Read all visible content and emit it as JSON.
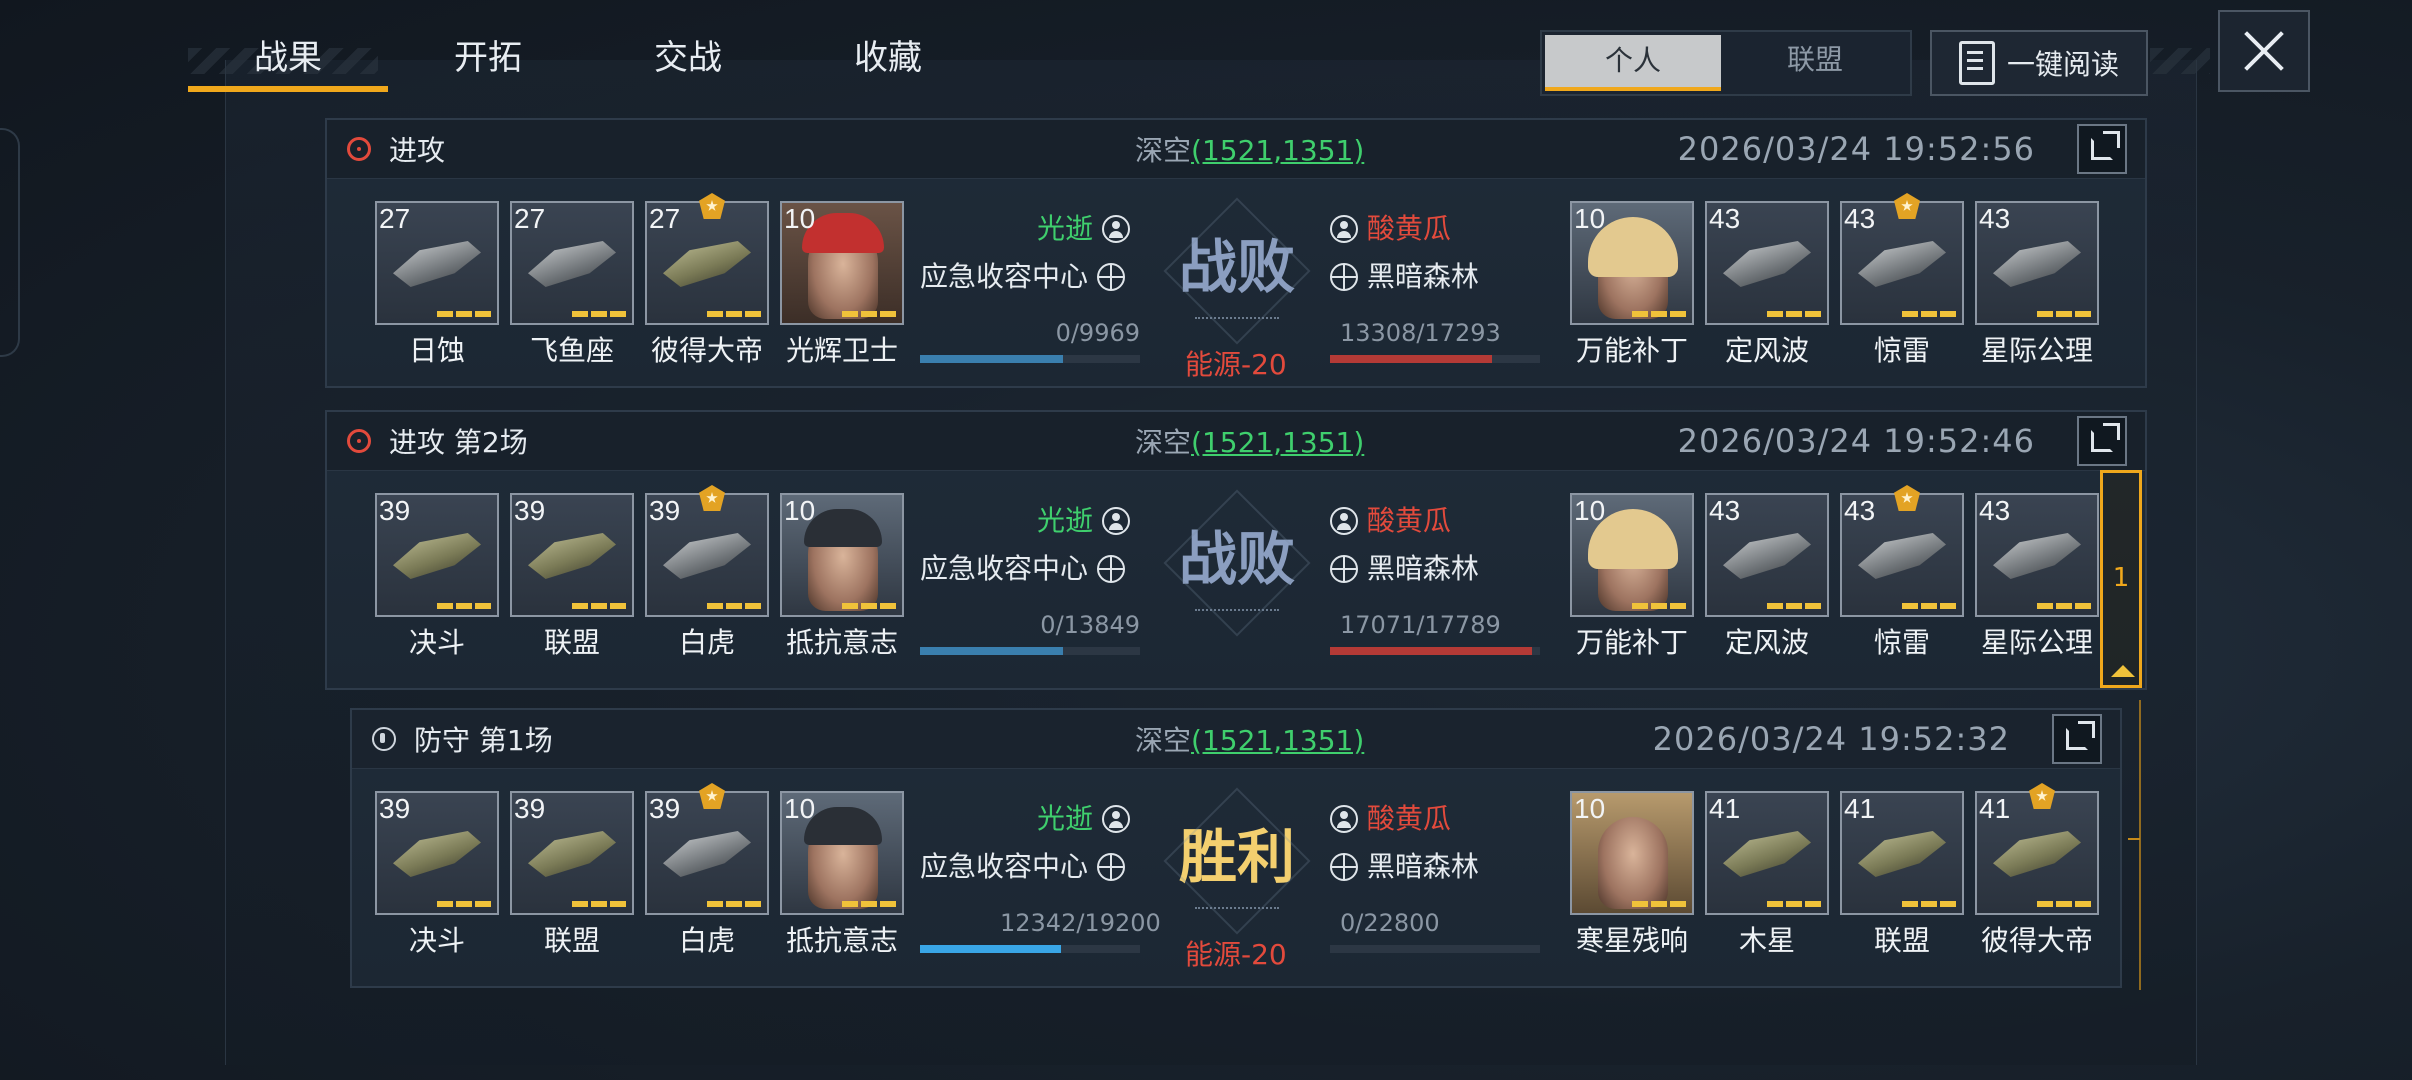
{
  "top_tabs": [
    {
      "label": "战果",
      "active": true
    },
    {
      "label": "开拓",
      "active": false
    },
    {
      "label": "交战",
      "active": false
    },
    {
      "label": "收藏",
      "active": false
    }
  ],
  "segment": {
    "personal": "个人",
    "alliance": "联盟"
  },
  "read_all_label": "一键阅读",
  "colors": {
    "accent": "#f0a81c",
    "ally": "#3fcf6d",
    "enemy": "#e24a3c",
    "lose": "#8b9ec0",
    "win": "#f3cf6f"
  },
  "battles": [
    {
      "title": "进攻",
      "type": "attack",
      "location": "深空",
      "coord": "(1521,1351)",
      "time": "2026/03/24 19:52:56",
      "left": {
        "player": "光逝",
        "guild": "应急收容中心",
        "hp": "0/9969",
        "hp_fraction": 0.65,
        "units": [
          {
            "level": "27",
            "name": "日蚀",
            "kind": "ship"
          },
          {
            "level": "27",
            "name": "飞鱼座",
            "kind": "ship"
          },
          {
            "level": "27",
            "name": "彼得大帝",
            "kind": "ship-olive",
            "star": true
          },
          {
            "level": "10",
            "name": "光辉卫士",
            "kind": "hero-turban"
          }
        ]
      },
      "result": "战败",
      "energy": "能源-20",
      "right": {
        "player": "酸黄瓜",
        "guild": "黑暗森林",
        "hp": "13308/17293",
        "hp_fraction": 0.77,
        "units": [
          {
            "level": "10",
            "name": "万能补丁",
            "kind": "hero-blonde"
          },
          {
            "level": "43",
            "name": "定风波",
            "kind": "ship"
          },
          {
            "level": "43",
            "name": "惊雷",
            "kind": "ship",
            "star": true
          },
          {
            "level": "43",
            "name": "星际公理",
            "kind": "ship"
          }
        ]
      }
    },
    {
      "title": "进攻 第2场",
      "type": "attack",
      "location": "深空",
      "coord": "(1521,1351)",
      "time": "2026/03/24 19:52:46",
      "left": {
        "player": "光逝",
        "guild": "应急收容中心",
        "hp": "0/13849",
        "hp_fraction": 0.65,
        "units": [
          {
            "level": "39",
            "name": "决斗",
            "kind": "ship-olive"
          },
          {
            "level": "39",
            "name": "联盟",
            "kind": "ship-olive"
          },
          {
            "level": "39",
            "name": "白虎",
            "kind": "ship",
            "star": true
          },
          {
            "level": "10",
            "name": "抵抗意志",
            "kind": "hero-dark"
          }
        ]
      },
      "result": "战败",
      "energy": "",
      "right": {
        "player": "酸黄瓜",
        "guild": "黑暗森林",
        "hp": "17071/17789",
        "hp_fraction": 0.96,
        "units": [
          {
            "level": "10",
            "name": "万能补丁",
            "kind": "hero-blonde"
          },
          {
            "level": "43",
            "name": "定风波",
            "kind": "ship"
          },
          {
            "level": "43",
            "name": "惊雷",
            "kind": "ship",
            "star": true
          },
          {
            "level": "43",
            "name": "星际公理",
            "kind": "ship"
          }
        ]
      }
    },
    {
      "title": "防守 第1场",
      "type": "defense",
      "location": "深空",
      "coord": "(1521,1351)",
      "time": "2026/03/24 19:52:32",
      "left": {
        "player": "光逝",
        "guild": "应急收容中心",
        "hp": "12342/19200",
        "hp_fraction": 0.64,
        "units": [
          {
            "level": "39",
            "name": "决斗",
            "kind": "ship-olive"
          },
          {
            "level": "39",
            "name": "联盟",
            "kind": "ship-olive"
          },
          {
            "level": "39",
            "name": "白虎",
            "kind": "ship",
            "star": true
          },
          {
            "level": "10",
            "name": "抵抗意志",
            "kind": "hero-dark"
          }
        ]
      },
      "result": "胜利",
      "energy": "能源-20",
      "right": {
        "player": "酸黄瓜",
        "guild": "黑暗森林",
        "hp": "0/22800",
        "hp_fraction": 0.0,
        "units": [
          {
            "level": "10",
            "name": "寒星残响",
            "kind": "hero-gold"
          },
          {
            "level": "41",
            "name": "木星",
            "kind": "ship-olive"
          },
          {
            "level": "41",
            "name": "联盟",
            "kind": "ship-olive"
          },
          {
            "level": "41",
            "name": "彼得大帝",
            "kind": "ship-olive",
            "star": true
          }
        ]
      }
    }
  ],
  "pager": {
    "page": "1"
  }
}
